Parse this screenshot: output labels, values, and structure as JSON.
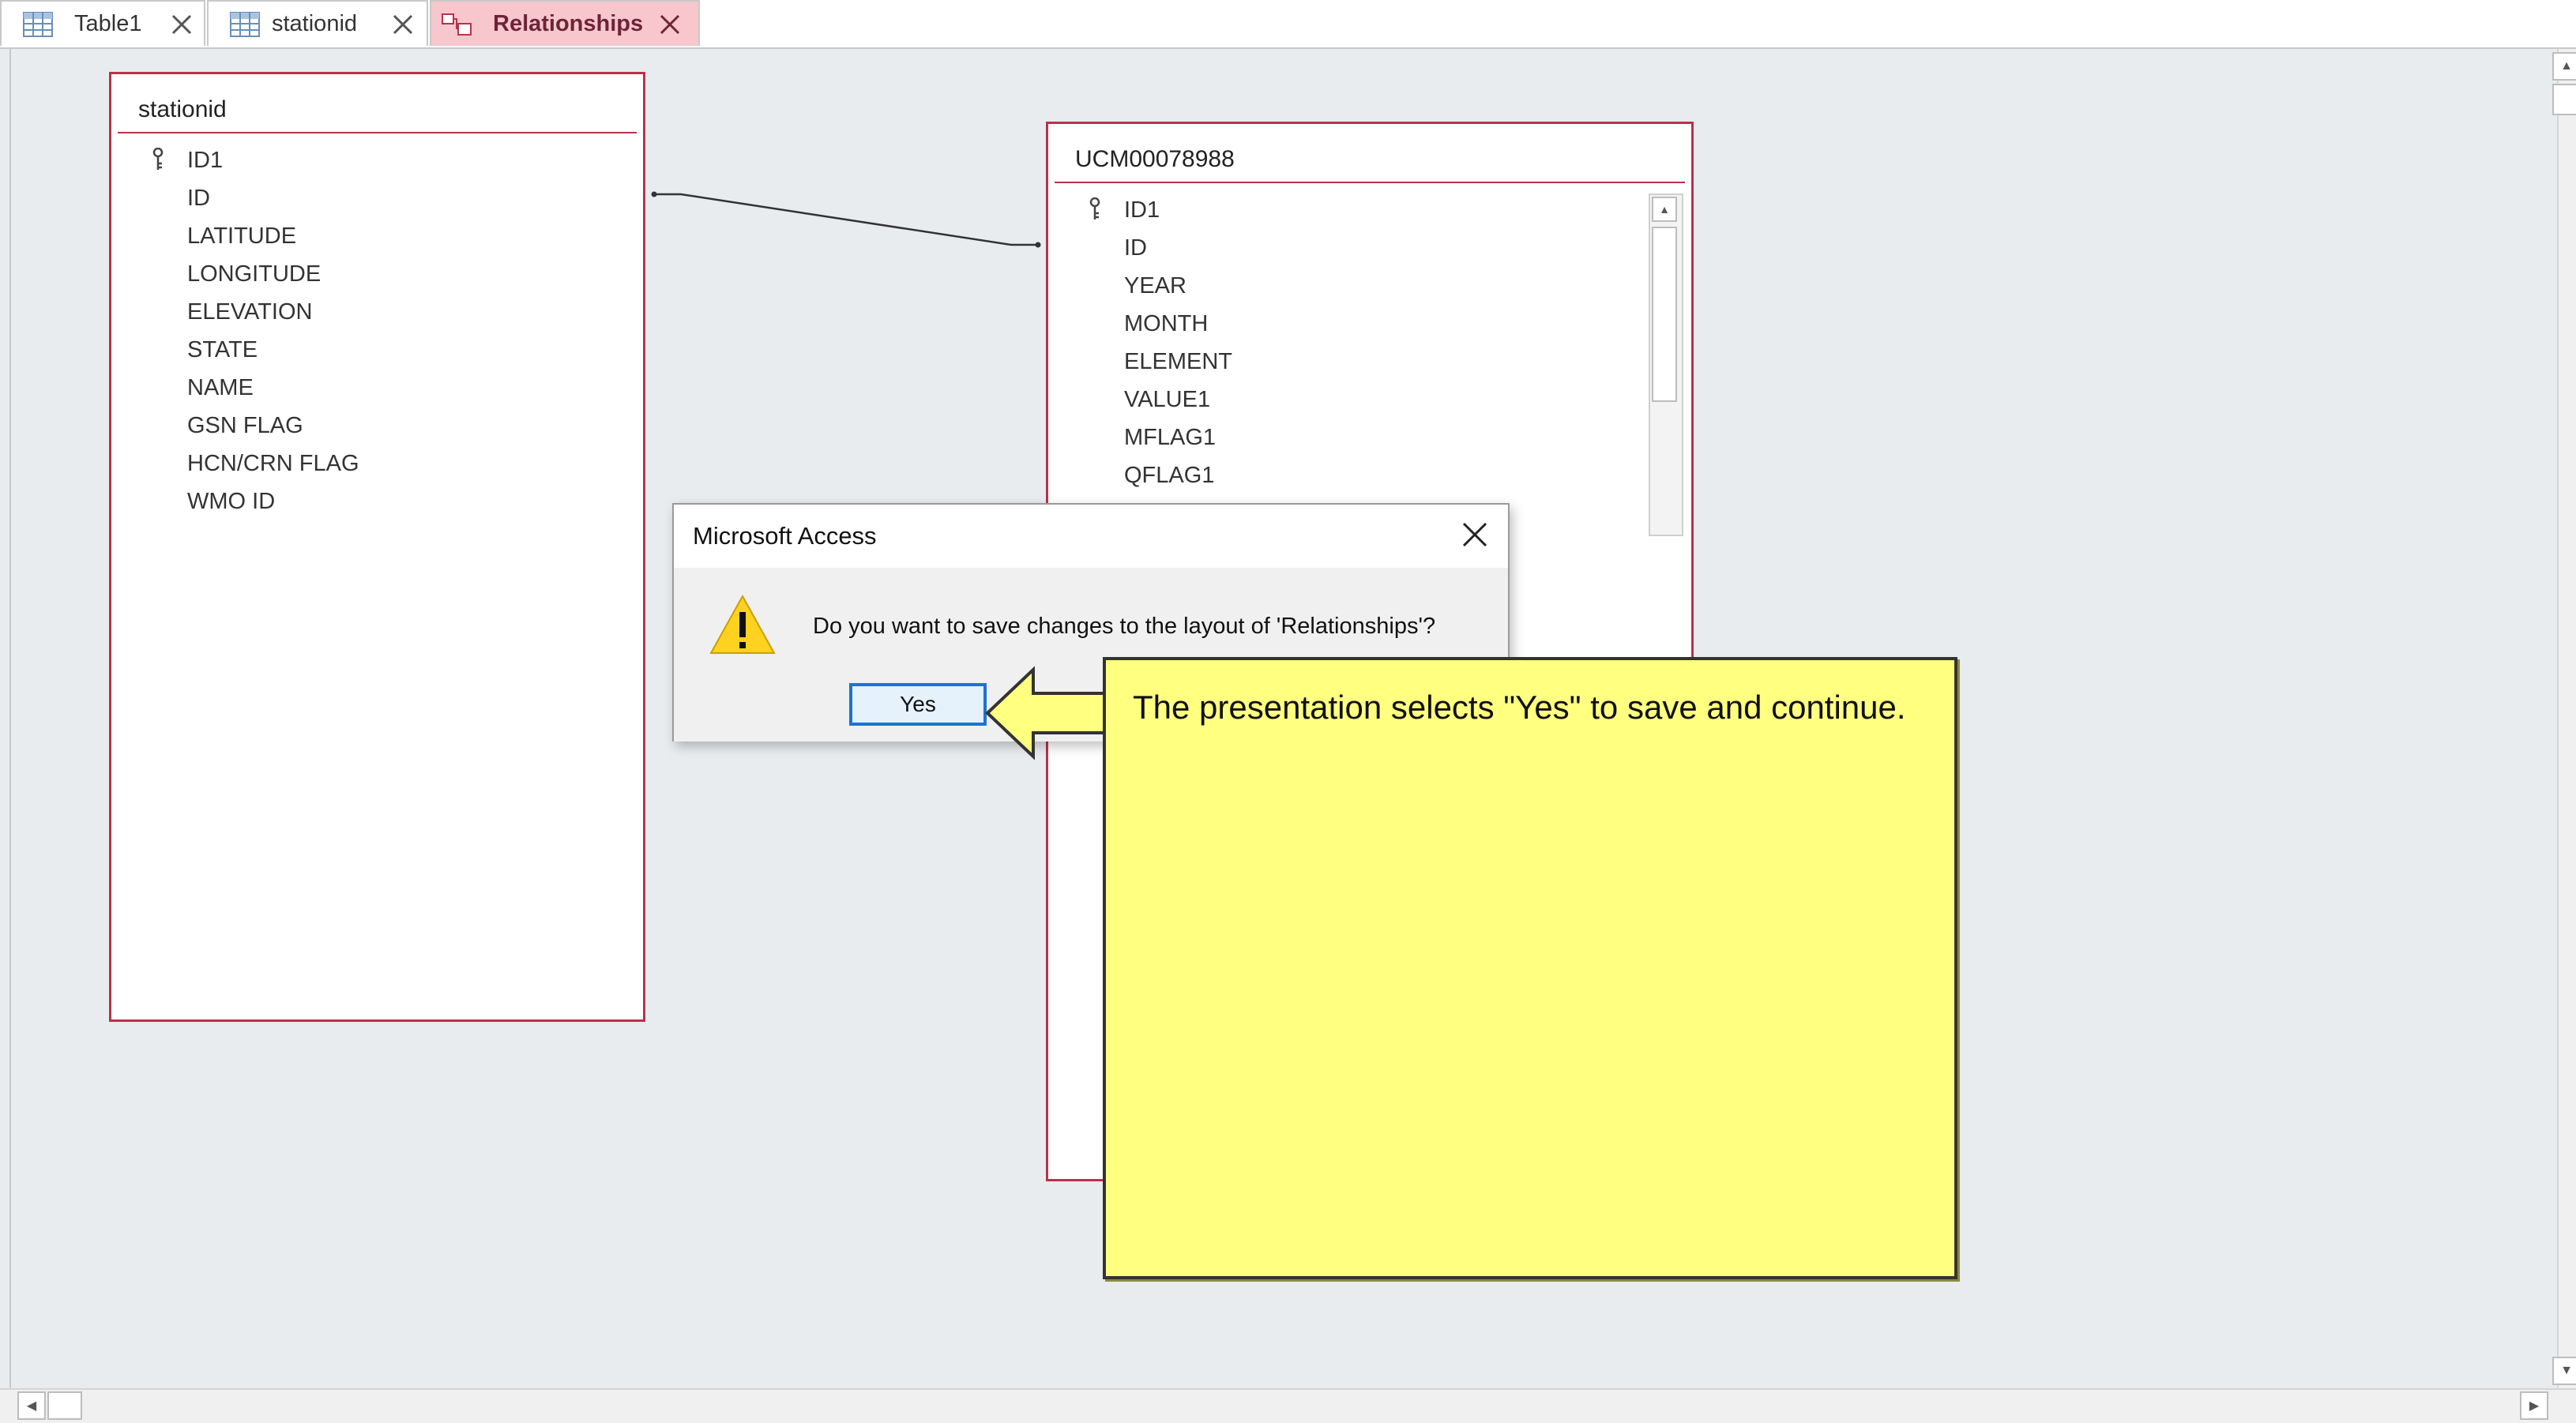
{
  "tabs": [
    {
      "label": "Table1",
      "icon": "table-icon",
      "active": false
    },
    {
      "label": "stationid",
      "icon": "table-icon",
      "active": false
    },
    {
      "label": "Relationships",
      "icon": "relationships-icon",
      "active": true
    }
  ],
  "tables": [
    {
      "name": "stationid",
      "fields": [
        "ID1",
        "ID",
        "LATITUDE",
        "LONGITUDE",
        "ELEVATION",
        "STATE",
        "NAME",
        "GSN FLAG",
        "HCN/CRN FLAG",
        "WMO ID"
      ],
      "primary_key": "ID1"
    },
    {
      "name": "UCM00078988",
      "fields": [
        "ID1",
        "ID",
        "YEAR",
        "MONTH",
        "ELEMENT",
        "VALUE1",
        "MFLAG1",
        "QFLAG1"
      ],
      "primary_key": "ID1"
    }
  ],
  "relationship": {
    "from": "stationid.ID",
    "to": "UCM00078988.ID"
  },
  "dialog": {
    "title": "Microsoft Access",
    "message": "Do you want to save changes to the layout of 'Relationships'?",
    "yes_label": "Yes",
    "icon": "warning-icon"
  },
  "callout": {
    "text": "The presentation selects \"Yes\" to save and continue.",
    "color": "#ffff80"
  },
  "colors": {
    "table_border": "#b8324a",
    "active_tab": "#f7c7cd",
    "default_button_border": "#1a74d2"
  }
}
